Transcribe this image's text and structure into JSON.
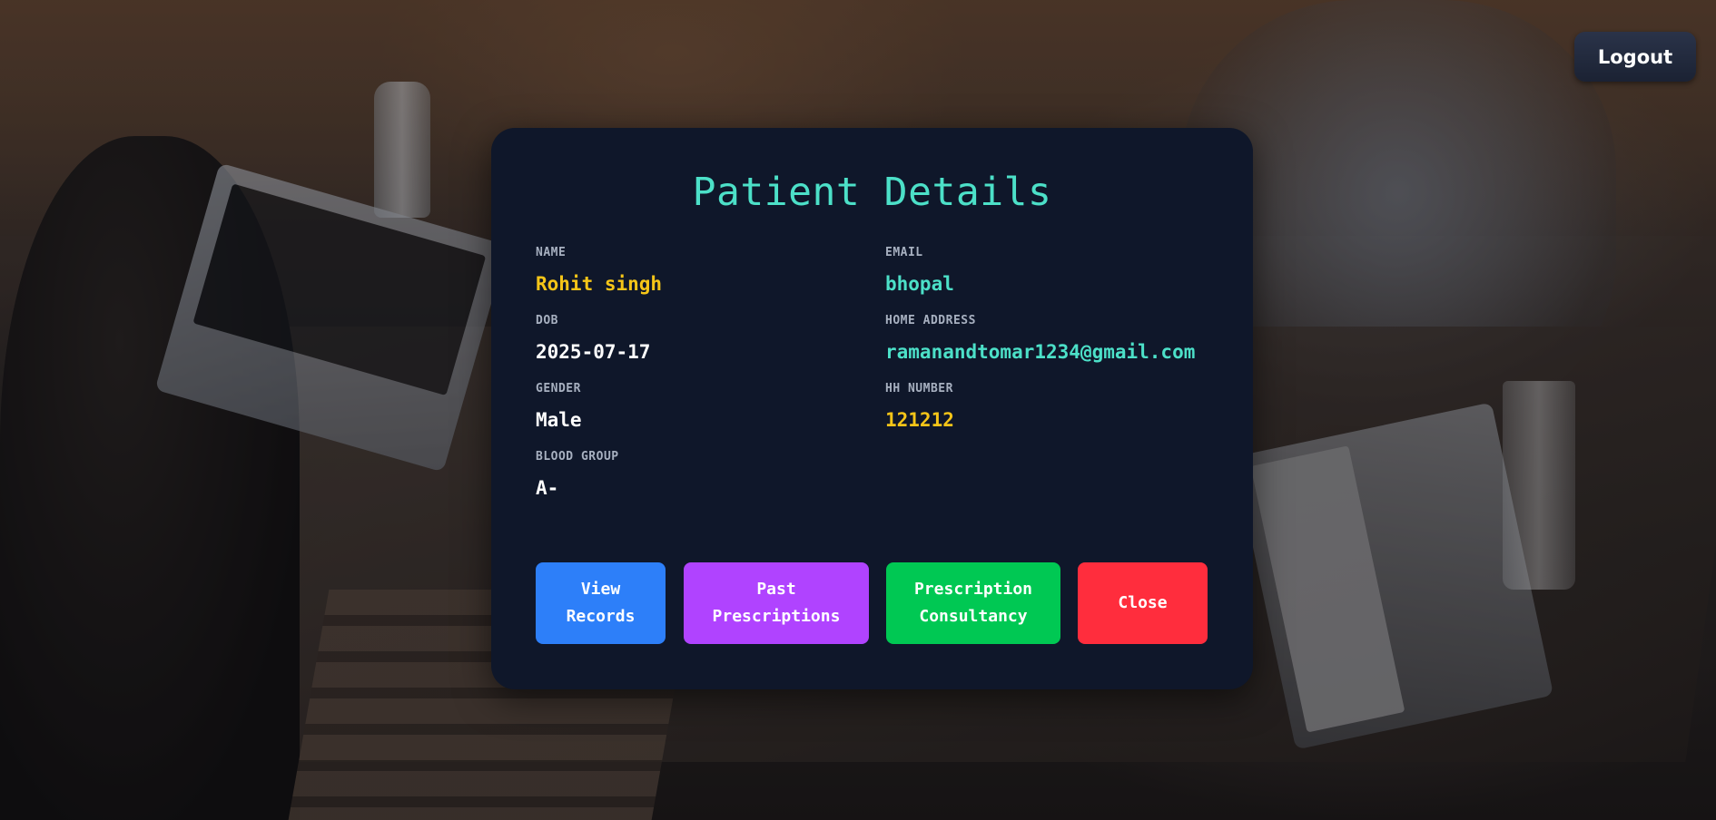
{
  "header": {
    "logout_label": "Logout"
  },
  "modal": {
    "title": "Patient Details",
    "fields": {
      "name": {
        "label": "NAME",
        "value": "Rohit singh"
      },
      "email": {
        "label": "EMAIL",
        "value": "bhopal"
      },
      "dob": {
        "label": "DOB",
        "value": "2025-07-17"
      },
      "home_address": {
        "label": "HOME ADDRESS",
        "value": "ramanandtomar1234@gmail.com"
      },
      "gender": {
        "label": "GENDER",
        "value": "Male"
      },
      "hh_number": {
        "label": "HH NUMBER",
        "value": "121212"
      },
      "blood_group": {
        "label": "BLOOD GROUP",
        "value": "A-"
      }
    },
    "buttons": {
      "view_records": {
        "line1": "View",
        "line2": "Records",
        "color": "#2d7ff9"
      },
      "past_prescriptions": {
        "line1": "Past",
        "line2": "Prescriptions",
        "color": "#b043ff"
      },
      "prescription_consultancy": {
        "line1": "Prescription",
        "line2": "Consultancy",
        "color": "#00c853"
      },
      "close": {
        "label": "Close",
        "color": "#ff2d3d"
      }
    }
  },
  "colors": {
    "card_background": "#0f172a",
    "title_accent": "#4ce0c8",
    "value_highlight": "#f5c518"
  }
}
